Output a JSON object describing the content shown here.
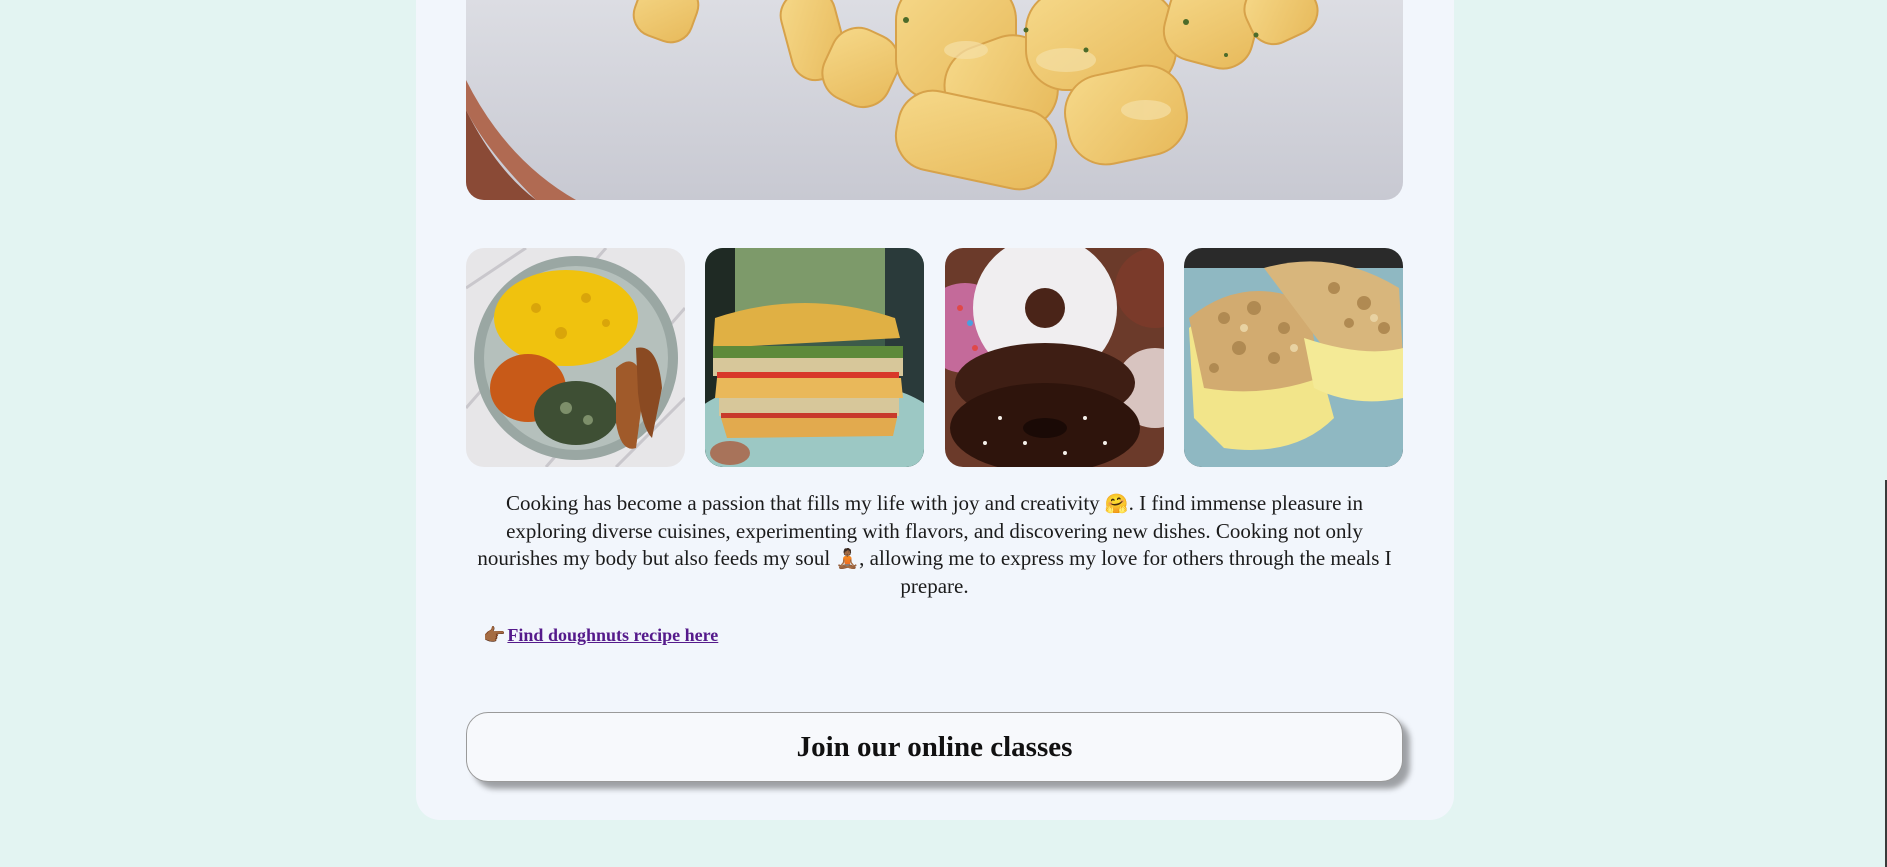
{
  "colors": {
    "page_background": "#e3f4f2",
    "card_background": "#f2f6fc",
    "link": "#551a8b"
  },
  "hero_image": {
    "icon": "mac-and-cheese-photo"
  },
  "gallery": [
    {
      "name": "jollof-rice-plate-photo"
    },
    {
      "name": "club-sandwich-photo"
    },
    {
      "name": "chocolate-doughnuts-photo"
    },
    {
      "name": "crumble-dessert-photo"
    }
  ],
  "description": {
    "part1": "Cooking has become a passion that fills my life with joy and creativity ",
    "emoji1": "🤗",
    "part2": ". I find immense pleasure in exploring diverse cuisines, experimenting with flavors, and discovering new dishes. Cooking not only nourishes my body but also feeds my soul ",
    "emoji2": "🧘🏾",
    "part3": ", allowing me to express my love for others through the meals I prepare."
  },
  "recipe_link": {
    "emoji": "👉🏾",
    "label": "Find doughnuts recipe here"
  },
  "join_button": {
    "label": "Join our online classes"
  }
}
